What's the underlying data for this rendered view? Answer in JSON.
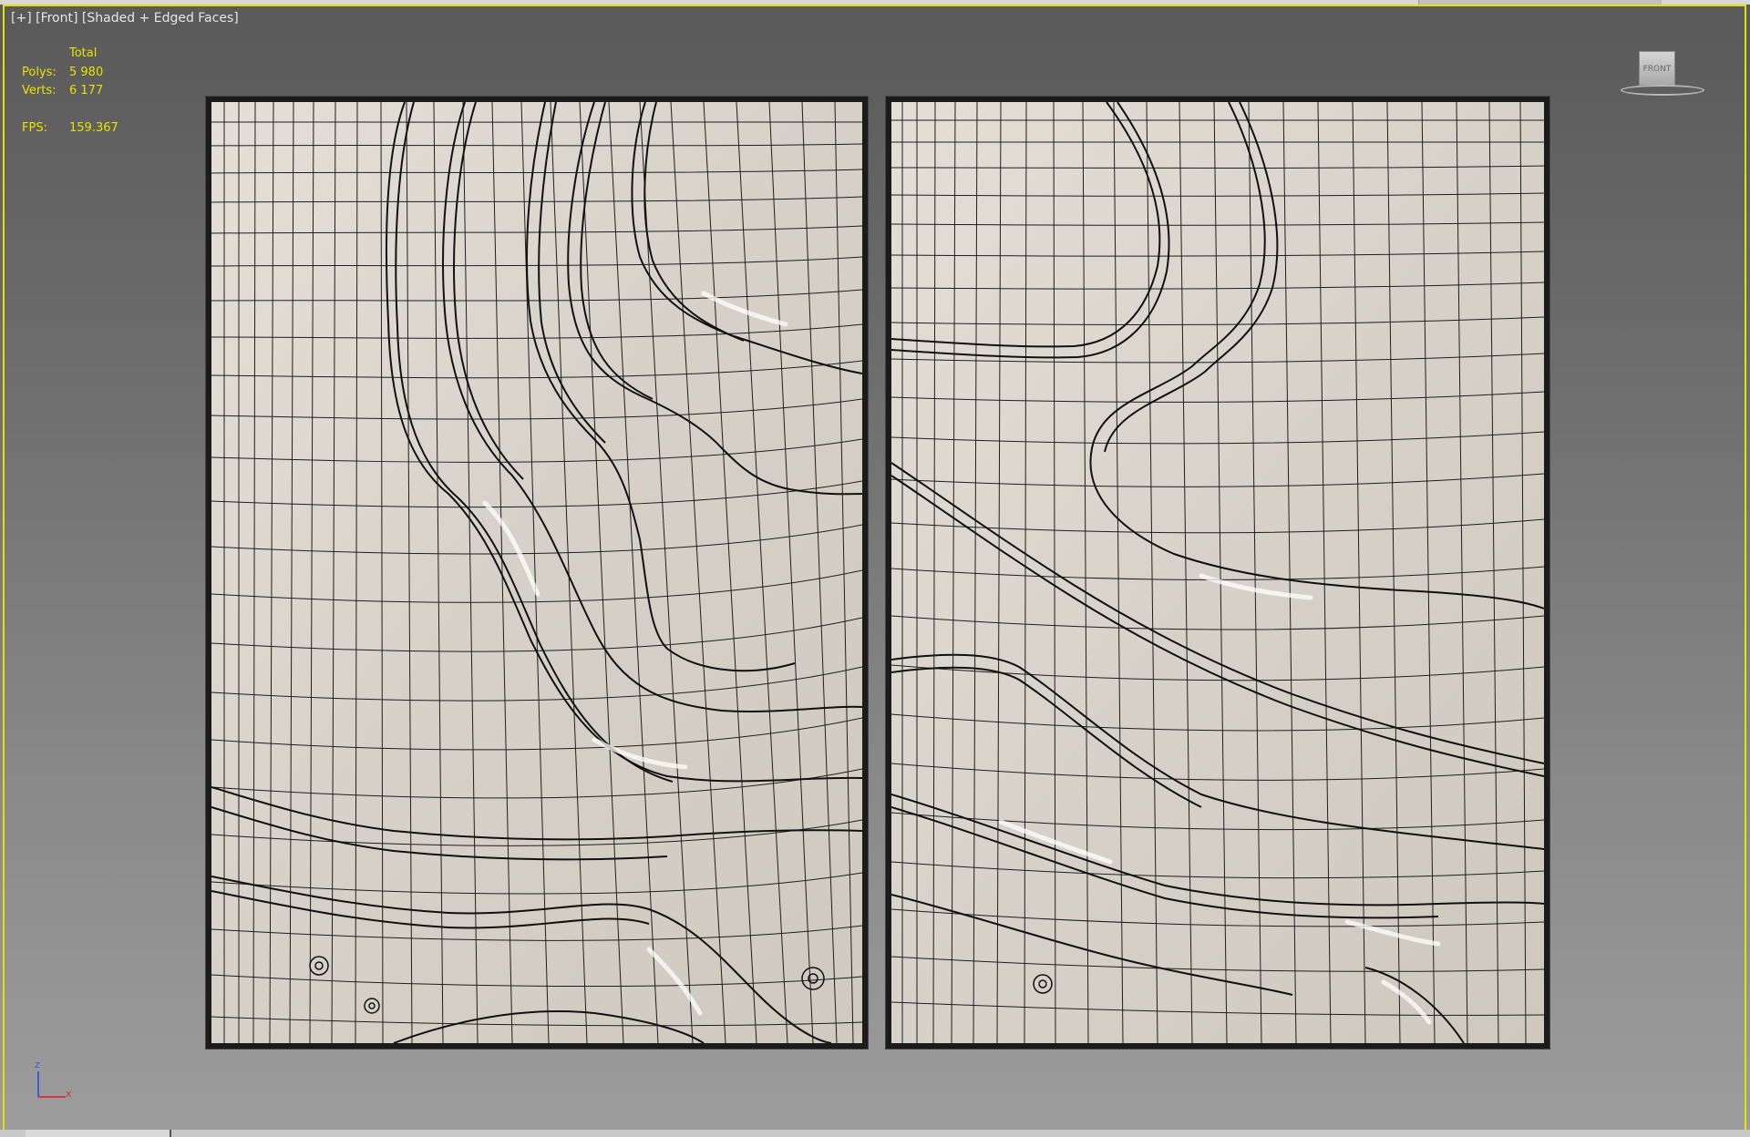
{
  "viewport": {
    "label_plus": "[+]",
    "label_view": "[Front]",
    "label_shading": "[Shaded + Edged Faces]"
  },
  "stats": {
    "header": "Total",
    "polys_label": "Polys:",
    "polys_value": "5 980",
    "verts_label": "Verts:",
    "verts_value": "6 177",
    "fps_label": "FPS:",
    "fps_value": "159.367"
  },
  "viewcube": {
    "face_label": "FRONT"
  },
  "axis": {
    "z": "z",
    "x": "x"
  },
  "colors": {
    "overlay_text": "#e9e200",
    "viewport_border": "#e8e000",
    "mesh_surface": "#ddd8cf",
    "wire": "#1a1a1a"
  }
}
